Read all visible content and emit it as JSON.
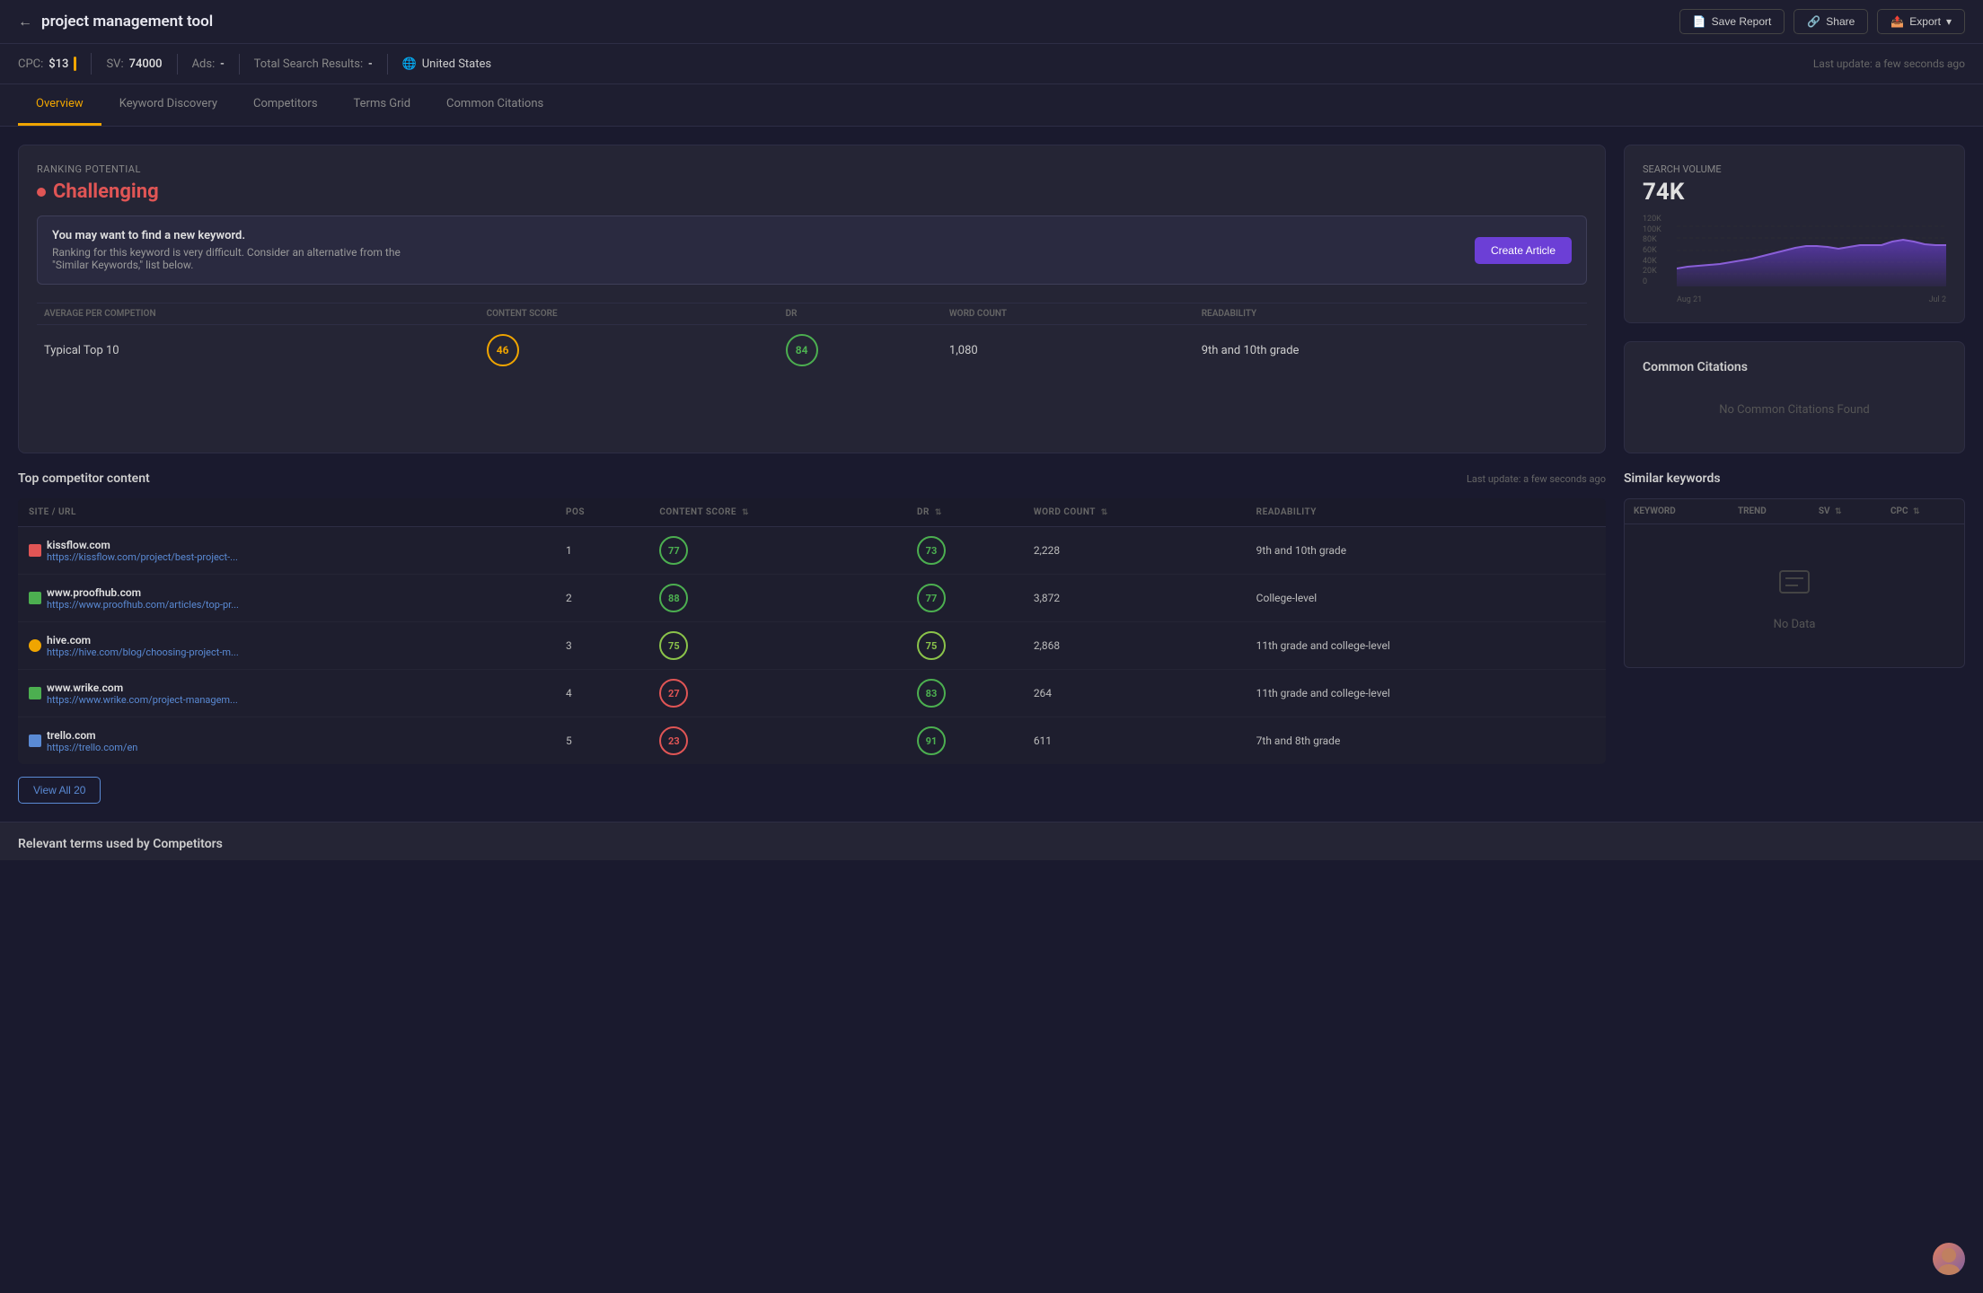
{
  "header": {
    "back_label": "←",
    "title": "project management tool",
    "save_report_label": "Save Report",
    "share_label": "Share",
    "export_label": "Export"
  },
  "stats": {
    "cpc_label": "CPC:",
    "cpc_value": "$13",
    "sv_label": "SV:",
    "sv_value": "74000",
    "ads_label": "Ads:",
    "ads_value": "-",
    "total_label": "Total Search Results:",
    "total_value": "-",
    "location": "United States",
    "last_update": "Last update: a few seconds ago"
  },
  "tabs": [
    {
      "label": "Overview",
      "active": true
    },
    {
      "label": "Keyword Discovery",
      "active": false
    },
    {
      "label": "Competitors",
      "active": false
    },
    {
      "label": "Terms Grid",
      "active": false
    },
    {
      "label": "Common Citations",
      "active": false
    }
  ],
  "ranking": {
    "section_label": "Ranking Potential",
    "value": "Challenging",
    "alert_title": "You may want to find a new keyword.",
    "alert_desc": "Ranking for this keyword is very difficult. Consider an alternative from the \"Similar Keywords,\" list below.",
    "create_article_label": "Create Article"
  },
  "metrics_table": {
    "col_avg": "AVERAGE PER COMPETION",
    "col_content": "CONTENT SCORE",
    "col_dr": "DR",
    "col_word": "WORD COUNT",
    "col_readability": "READABILITY",
    "rows": [
      {
        "label": "Typical Top 10",
        "content_score": "46",
        "dr": "84",
        "word_count": "1,080",
        "readability": "9th and 10th grade",
        "content_color": "orange",
        "dr_color": "green"
      }
    ]
  },
  "search_volume": {
    "label": "Search Volume",
    "value": "74K",
    "chart": {
      "y_labels": [
        "120K",
        "100K",
        "80K",
        "60K",
        "40K",
        "20K",
        "0"
      ],
      "x_labels": [
        "Aug 21",
        "Jul 2"
      ],
      "data": [
        45000,
        46000,
        47000,
        48000,
        50000,
        52000,
        55000,
        58000,
        60000,
        65000,
        68000,
        72000,
        74000,
        74000,
        72000,
        68000,
        70000,
        73000,
        75000,
        74000,
        74000,
        78000,
        80000,
        76000,
        74000
      ]
    }
  },
  "common_citations": {
    "title": "Common Citations",
    "no_data": "No Common Citations Found"
  },
  "competitor_content": {
    "title": "Top competitor content",
    "last_update": "Last update: a few seconds ago",
    "cols": {
      "site": "SITE / URL",
      "pos": "POS",
      "content_score": "CONTENT SCORE",
      "dr": "DR",
      "word_count": "WORD COUNT",
      "readability": "READABILITY"
    },
    "rows": [
      {
        "site": "kissflow.com",
        "url": "https://kissflow.com/project/best-project-...",
        "pos": 1,
        "content_score": 77,
        "cs_color": "green",
        "dr": 73,
        "dr_color": "green",
        "word_count": "2,228",
        "readability": "9th and 10th grade",
        "favicon_color": "#e05555"
      },
      {
        "site": "www.proofhub.com",
        "url": "https://www.proofhub.com/articles/top-pr...",
        "pos": 2,
        "content_score": 88,
        "cs_color": "green",
        "dr": 77,
        "dr_color": "green",
        "word_count": "3,872",
        "readability": "College-level",
        "favicon_color": "#4caf50"
      },
      {
        "site": "hive.com",
        "url": "https://hive.com/blog/choosing-project-m...",
        "pos": 3,
        "content_score": 75,
        "cs_color": "lime",
        "dr": 75,
        "dr_color": "lime",
        "word_count": "2,868",
        "readability": "11th grade and college-level",
        "favicon_color": "#f0a500"
      },
      {
        "site": "www.wrike.com",
        "url": "https://www.wrike.com/project-managem...",
        "pos": 4,
        "content_score": 27,
        "cs_color": "red",
        "dr": 83,
        "dr_color": "green",
        "word_count": "264",
        "readability": "11th grade and college-level",
        "favicon_color": "#4caf50"
      },
      {
        "site": "trello.com",
        "url": "https://trello.com/en",
        "pos": 5,
        "content_score": 23,
        "cs_color": "red",
        "dr": 91,
        "dr_color": "green",
        "word_count": "611",
        "readability": "7th and 8th grade",
        "favicon_color": "#5a8ad4"
      }
    ],
    "view_all_label": "View All 20"
  },
  "similar_keywords": {
    "title": "Similar keywords",
    "cols": {
      "keyword": "KEYWORD",
      "trend": "TREND",
      "sv": "SV",
      "cpc": "CPC"
    },
    "no_data": "No Data"
  },
  "relevant_footer": {
    "title": "Relevant terms used by Competitors"
  }
}
